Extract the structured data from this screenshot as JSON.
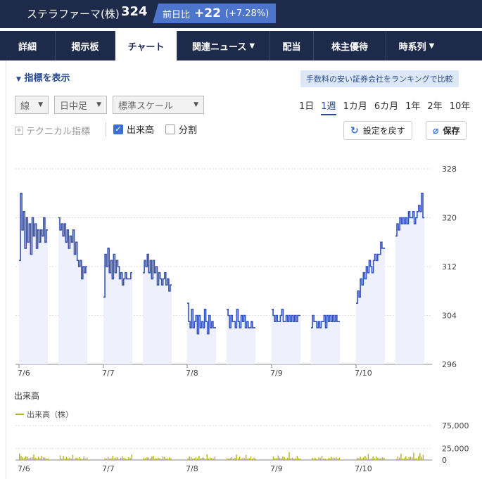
{
  "header": {
    "name": "ステラファーマ(株)",
    "price": "324",
    "change_label": "前日比",
    "change": "+22",
    "change_pct": "(+7.28%)"
  },
  "tabs": [
    {
      "label": "詳細"
    },
    {
      "label": "掲示板"
    },
    {
      "label": "チャート"
    },
    {
      "label": "関連ニュース",
      "dropdown": true
    },
    {
      "label": "配当"
    },
    {
      "label": "株主優待"
    },
    {
      "label": "時系列",
      "dropdown": true
    }
  ],
  "active_tab": 2,
  "toolbar": {
    "indicator_toggle": "指標を表示",
    "ad_link": "手数料の安い証券会社をランキングで比較",
    "chart_type": "線",
    "interval": "日中足",
    "scale": "標準スケール",
    "periods": [
      "1日",
      "1週",
      "1カ月",
      "6カ月",
      "1年",
      "2年",
      "10年"
    ],
    "active_period": 1,
    "technical": "テクニカル指標",
    "volume_check": "出来高",
    "split_check": "分割",
    "reset": "設定を戻す",
    "save": "保存"
  },
  "colors": {
    "line": "#3552b8",
    "area": "#eef1fb",
    "volume": "#b5b01e",
    "accent": "#2a4b8d"
  },
  "chart_data": [
    {
      "type": "line",
      "x_ticks": [
        "7/6",
        "7/7",
        "7/8",
        "7/9",
        "7/10"
      ],
      "ylim": [
        296,
        328
      ],
      "y_ticks": [
        296,
        304,
        312,
        320,
        328
      ],
      "grid": true,
      "sessions": [
        {
          "day": "7/6",
          "values": [
            313,
            324,
            318,
            321,
            315,
            320,
            316,
            319,
            314,
            320,
            317,
            319,
            315,
            318,
            316,
            318,
            317,
            320,
            316,
            318
          ]
        },
        {
          "day": "7/6",
          "values": [
            320,
            318,
            319,
            317,
            319,
            316,
            318,
            315,
            317,
            316,
            318,
            314,
            316,
            313,
            312,
            313,
            310,
            312,
            311,
            312
          ]
        },
        {
          "day": "7/7",
          "values": [
            307,
            314,
            312,
            315,
            311,
            313,
            310,
            314,
            311,
            313,
            312,
            310,
            311,
            309,
            310,
            311,
            310,
            310,
            310,
            311
          ]
        },
        {
          "day": "7/7",
          "values": [
            311,
            313,
            312,
            314,
            311,
            313,
            310,
            313,
            311,
            312,
            309,
            311,
            310,
            309,
            310,
            311,
            309,
            310,
            308,
            309
          ]
        },
        {
          "day": "7/8",
          "values": [
            306,
            303,
            302,
            305,
            302,
            303,
            304,
            301,
            304,
            302,
            303,
            302,
            305,
            303,
            301,
            304,
            302,
            303,
            302,
            302
          ]
        },
        {
          "day": "7/8",
          "values": [
            305,
            304,
            302,
            304,
            303,
            303,
            302,
            305,
            303,
            302,
            304,
            303,
            304,
            302,
            303,
            302,
            302,
            303,
            302,
            302
          ]
        },
        {
          "day": "7/9",
          "values": [
            305,
            304,
            303,
            304,
            303,
            303,
            304,
            305,
            303,
            303,
            304,
            303,
            304,
            303,
            304,
            303,
            304,
            303,
            304,
            304
          ]
        },
        {
          "day": "7/9",
          "values": [
            302,
            304,
            303,
            303,
            302,
            303,
            302,
            303,
            303,
            304,
            302,
            304,
            303,
            304,
            303,
            304,
            303,
            304,
            303,
            303
          ]
        },
        {
          "day": "7/10",
          "values": [
            306,
            308,
            307,
            310,
            309,
            311,
            310,
            312,
            311,
            313,
            312,
            311,
            313,
            314,
            313,
            314,
            314,
            316,
            315,
            315
          ]
        },
        {
          "day": "7/10",
          "values": [
            317,
            319,
            318,
            320,
            319,
            320,
            319,
            320,
            319,
            321,
            320,
            320,
            321,
            319,
            320,
            321,
            322,
            321,
            324,
            320
          ]
        }
      ]
    },
    {
      "type": "bar",
      "title": "出来高",
      "legend": "出来高（株）",
      "ylim": [
        0,
        75000
      ],
      "y_ticks": [
        "0",
        "25,000",
        "75,000"
      ],
      "series": [
        {
          "values": [
            14000,
            9000,
            6000,
            5000,
            8000,
            7000,
            4000,
            5000,
            6000,
            12000,
            5000,
            4000,
            7000,
            4000,
            9000,
            6000,
            5000,
            3000,
            4000,
            10000,
            2000,
            9000,
            3000,
            7000,
            4000,
            5000,
            3000,
            11000,
            2000,
            5000,
            4000,
            6000,
            3000,
            2000,
            8000,
            3000,
            5000,
            4000,
            3000,
            7000,
            3000,
            4000,
            9000,
            4000,
            5000,
            6000,
            2000,
            5000,
            8000,
            5000,
            3000,
            2000,
            6000,
            4000,
            12000,
            5000,
            4000,
            6000,
            5000,
            4000,
            8000,
            9000,
            4000,
            3000,
            5000,
            4000,
            2000,
            8000,
            7000,
            3000,
            3000,
            6000,
            4000,
            4000,
            8000,
            6000,
            3000,
            4000,
            6000,
            3000,
            9000,
            4000,
            5000,
            5000,
            2000,
            12000,
            3000,
            5000,
            4000,
            3000,
            7000,
            4000,
            3000,
            4000,
            6000,
            3000,
            5000,
            12000,
            4000,
            7000,
            3000,
            5000,
            4000,
            11000,
            3000,
            4000,
            8000,
            3000,
            5000,
            3000,
            8000,
            4000,
            4000,
            10000,
            5000,
            4000,
            8000,
            6000,
            3000,
            5000,
            17000,
            4000,
            5000,
            3000,
            4000,
            9000,
            4000,
            3000,
            5000,
            4000,
            4000,
            2000,
            6000,
            4000,
            9000,
            3000,
            3000,
            2000,
            4000,
            4000,
            7000,
            5000,
            4000,
            6000,
            3000,
            5000,
            5000,
            4000,
            7000,
            4000,
            6000,
            9000,
            5000,
            13000,
            2000,
            3000,
            8000,
            4000,
            8000,
            5000,
            3000,
            5000,
            6000,
            5000,
            2000,
            8000,
            5000,
            14000,
            3000,
            4000,
            8000,
            3000,
            6000,
            7000,
            6000,
            16000,
            3000,
            4000,
            8000,
            15000,
            7000,
            11000
          ]
        }
      ]
    }
  ]
}
